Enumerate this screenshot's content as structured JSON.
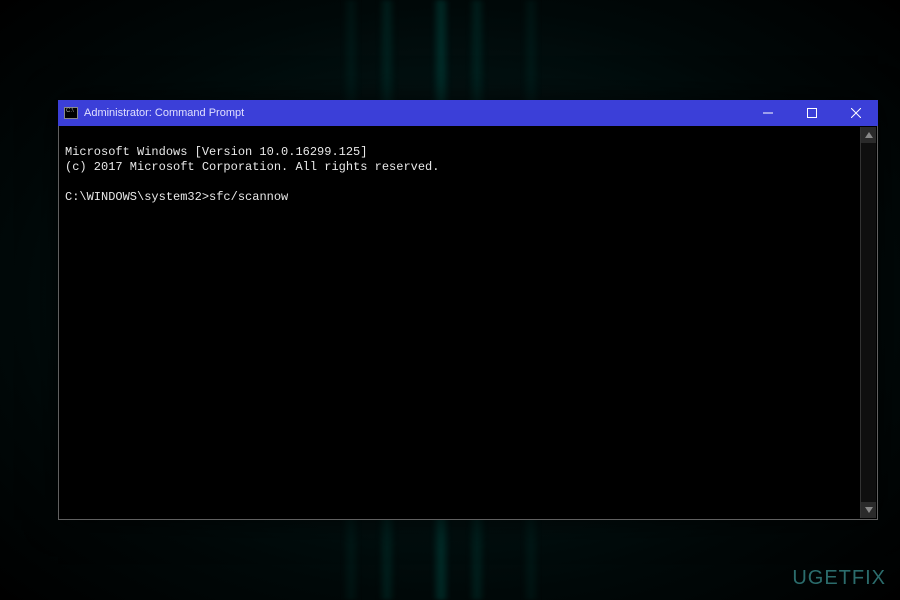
{
  "window": {
    "title": "Administrator: Command Prompt"
  },
  "terminal": {
    "line1": "Microsoft Windows [Version 10.0.16299.125]",
    "line2": "(c) 2017 Microsoft Corporation. All rights reserved.",
    "blank": "",
    "prompt": "C:\\WINDOWS\\system32>",
    "command": "sfc/scannow"
  },
  "watermark": {
    "text": "UGETFIX"
  },
  "colors": {
    "titlebar": "#3b3fd8",
    "terminal_bg": "#000000",
    "terminal_fg": "#e8e8e8"
  }
}
